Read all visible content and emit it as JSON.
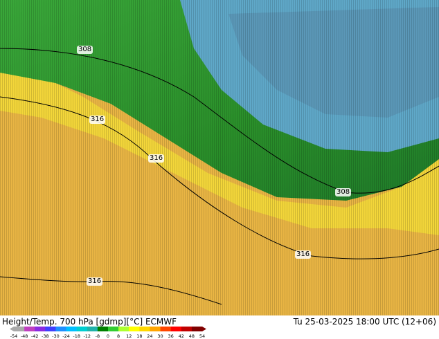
{
  "map": {
    "title": "Height/Temp. 700 hPa [gdmp][°C] ECMWF",
    "valid_time": "Tu 25-03-2025 18:00 UTC (12+06)",
    "contour_labels": [
      "308",
      "316",
      "316",
      "308",
      "316",
      "316"
    ],
    "colorbar": {
      "ticks": [
        "-54",
        "-48",
        "-42",
        "-38",
        "-30",
        "-24",
        "-18",
        "-12",
        "-8",
        "0",
        "8",
        "12",
        "18",
        "24",
        "30",
        "36",
        "42",
        "48",
        "54"
      ],
      "colors": [
        "#a9a9a9",
        "#c040c0",
        "#8a2be2",
        "#4040ff",
        "#1e90ff",
        "#00bfff",
        "#00ced1",
        "#20b2aa",
        "#008000",
        "#32cd32",
        "#adff2f",
        "#ffff00",
        "#ffd700",
        "#ffa500",
        "#ff4500",
        "#ff0000",
        "#c00000",
        "#800000"
      ]
    },
    "palette": {
      "cold": "#5fa8c8",
      "mid": "#2e9a2e",
      "warm": "#f2d23c",
      "hot": "#e8b040"
    }
  }
}
